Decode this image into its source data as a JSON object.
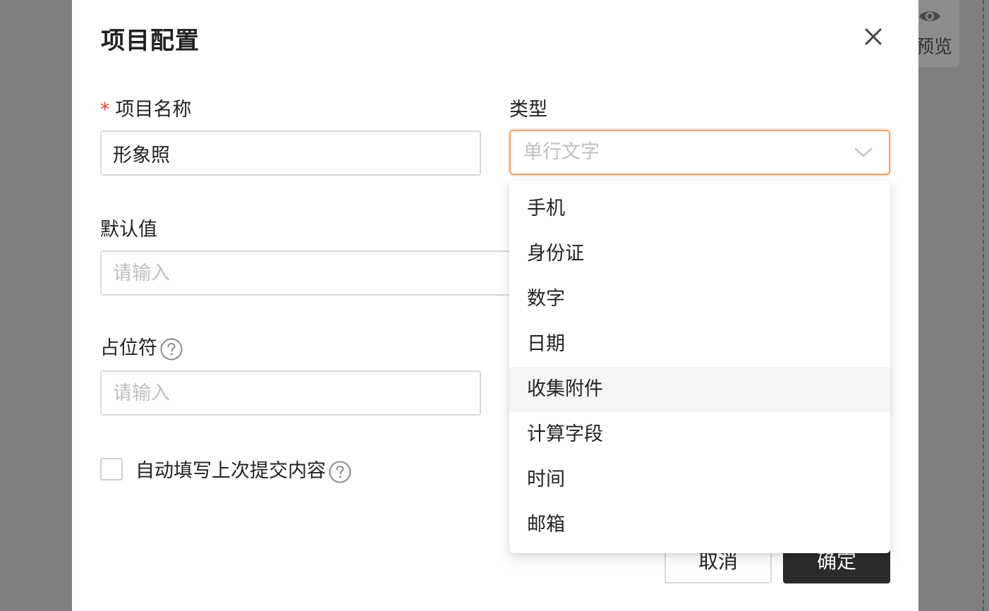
{
  "background": {
    "preview_label": "预览",
    "preview_icon": "eye-icon"
  },
  "modal": {
    "title": "项目配置",
    "close_icon": "close-icon"
  },
  "form": {
    "name": {
      "required_mark": "*",
      "label": "项目名称",
      "value": "形象照"
    },
    "type": {
      "label": "类型",
      "selected": "单行文字",
      "icon": "chevron-down-icon"
    },
    "default_value": {
      "label": "默认值",
      "placeholder": "请输入"
    },
    "placeholder_field": {
      "label": "占位符",
      "placeholder": "请输入",
      "icon": "question-circle-icon"
    },
    "autofill": {
      "label": "自动填写上次提交内容",
      "checked": false,
      "icon": "question-circle-icon"
    }
  },
  "dropdown": {
    "options": [
      "手机",
      "身份证",
      "数字",
      "日期",
      "收集附件",
      "计算字段",
      "时间",
      "邮箱"
    ],
    "hovered": "收集附件"
  },
  "footer": {
    "cancel_label": "取消",
    "ok_label": "确定"
  },
  "colors": {
    "required": "#f04134",
    "select_focus_border": "#f3a374",
    "primary_button": "#2b2b2b",
    "overlay": "#7f7f7f"
  }
}
